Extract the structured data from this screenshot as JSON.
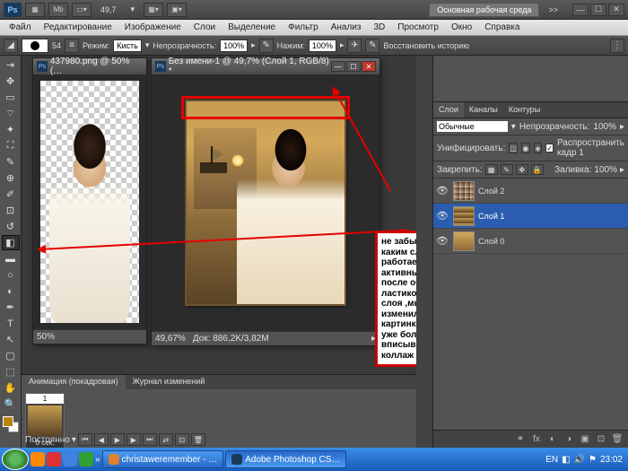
{
  "titlebar": {
    "zoom": "49,7",
    "workspace": "Основная рабочая среда",
    "more": ">>"
  },
  "menu": {
    "file": "Файл",
    "edit": "Редактирование",
    "image": "Изображение",
    "layer": "Слои",
    "select": "Выделение",
    "filter": "Фильтр",
    "analysis": "Анализ",
    "threeD": "3D",
    "view": "Просмотр",
    "window": "Окно",
    "help": "Справка"
  },
  "options": {
    "brush_size": "54",
    "mode_lbl": "Режим:",
    "mode_val": "Кисть",
    "opacity_lbl": "Непрозрачность:",
    "opacity_val": "100%",
    "flow_lbl": "Нажим:",
    "flow_val": "100%",
    "history": "Восстановить историю"
  },
  "doc1": {
    "title": "437980.png @ 50% (…",
    "zoom": "50%"
  },
  "doc2": {
    "title": "Без имени-1 @ 49,7% (Слой 1, RGB/8) *",
    "zoom": "49,67%",
    "status": "Док: 886,2K/3,82M"
  },
  "annotation": "не забываем ,что с каким слоем мы работаем тот слой и активный...теперь после обработки ластиком второго слоя ,мы видим как изменилась картинка...и девушка уже больше вписывается в этот коллаж",
  "animation": {
    "tab1": "Анимация (покадровая)",
    "tab2": "Журнал изменений",
    "frame_num": "1",
    "frame_time": "0 сек.",
    "loop": "Постоянно"
  },
  "panels": {
    "tab_layers": "Слои",
    "tab_channels": "Каналы",
    "tab_paths": "Контуры",
    "blend": "Обычные",
    "opacity_lbl": "Непрозрачность:",
    "opacity_val": "100%",
    "unify_lbl": "Унифицировать:",
    "propagate": "Распространить кадр 1",
    "lock_lbl": "Закрепить:",
    "fill_lbl": "Заливка:",
    "fill_val": "100%",
    "layers": [
      {
        "name": "Слой 2"
      },
      {
        "name": "Слой 1"
      },
      {
        "name": "Слой 0"
      }
    ]
  },
  "taskbar": {
    "app1": "christaweremember - …",
    "app2": "Adobe Photoshop CS…",
    "lang": "EN",
    "time": "23:02"
  }
}
